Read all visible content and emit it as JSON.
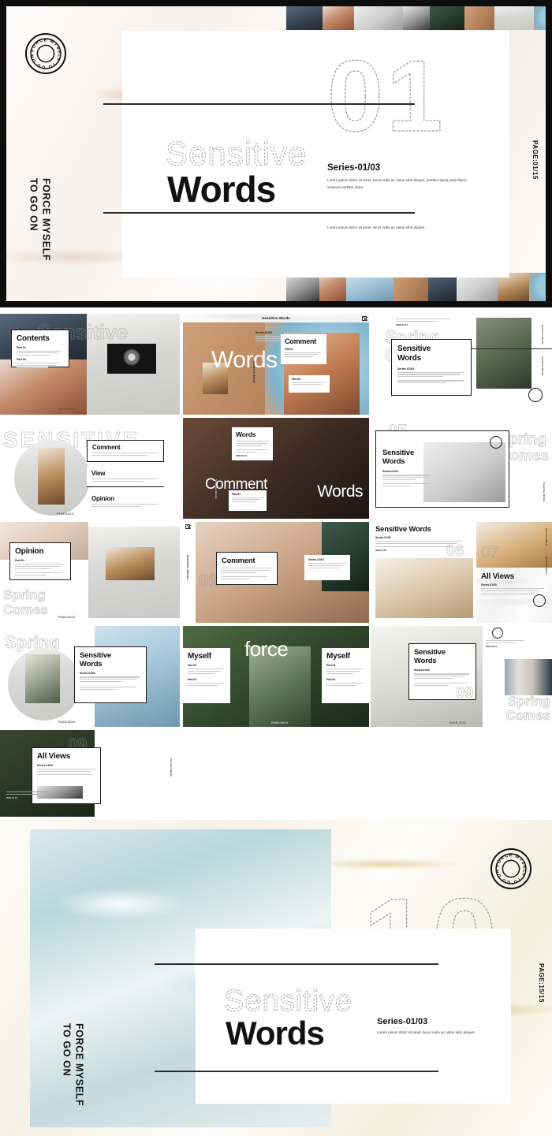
{
  "brand": {
    "stamp_text": "FORCE MYSELF TO GO ON",
    "vertical_line1": "FORCE MYSELF",
    "vertical_line2": "TO GO ON"
  },
  "hero_top": {
    "page_label": "PAGE:01/15",
    "number": "01",
    "outline_word": "Sensitive",
    "title": "Words",
    "series": "Series-01/03",
    "body1": "Lorem ipsum dolor sit amet, lacus nulla ac natus nibh aliquet, porttitor ligula justo libero vivamus porttitor dolor.",
    "body2": "Lorem ipsum dolor sit amet, lacus nulla ac natus nibh aliquet."
  },
  "hero_bottom": {
    "page_label": "PAGE:15/15",
    "number": "10",
    "outline_word": "Sensitive",
    "title": "Words",
    "series": "Series-01/03",
    "body1": "Lorem ipsum dolor sit amet, lacus nulla ac natus nibh aliquet."
  },
  "common": {
    "series_label": "Series-01/03",
    "quote": "If I force myself to go on loving you, Then I break down.",
    "date": "2020.04.01",
    "window_title": "Sensitive Words",
    "vertical_label": "Sensitive Words",
    "part_lorem": "Lorem ipsum dolor sit amet, lacus nulla ac natus nibh aliquet porttitor ligula justo libero.",
    "body_lorem": "Lorem ipsum dolor sit amet, lacus nulla ac natus nibh aliquet porttitor ligula justo libero vivamus porttitor dolor."
  },
  "slides": [
    {
      "id": "s01-contents",
      "panel_title": "Contents",
      "parts": [
        "Part.01",
        "Part.02"
      ],
      "ghost_word": "Sensitive",
      "page_tag": "PAGE:02/15"
    },
    {
      "id": "s02-words-comment",
      "window_title": "Sensitive Words",
      "big_word": "Words",
      "panel_title": "Comment",
      "series": "Series-01/03",
      "parts": [
        "Part.01",
        "Part.02"
      ]
    },
    {
      "id": "s03-sensitive-skate",
      "panel_title_l1": "Sensitive",
      "panel_title_l2": "Words",
      "series": "Series-01/03",
      "ghost_word_l1": "Spring",
      "ghost_word_l2": "Comes",
      "ghost_num": "03",
      "quote": "If I force myself to go on loving you, Then I break down.",
      "date": "2020.04.01"
    },
    {
      "id": "s04-sensitive-ghost",
      "ghost_word": "SENSITIVE",
      "menu": [
        "Comment",
        "View",
        "Opinion"
      ],
      "page_tag": "PAGE:04/15"
    },
    {
      "id": "s05-comment-dark",
      "panel_title": "Words",
      "big_word_l": "Comment",
      "big_word_r": "Words",
      "part": "Part.01",
      "date": "2020.04.01"
    },
    {
      "id": "s06-book",
      "panel_title_l1": "Sensitive",
      "panel_title_l2": "Words",
      "series": "Series-01/03",
      "ghost_num": "05",
      "ghost_word_l1": "Spring",
      "ghost_word_l2": "Comes"
    },
    {
      "id": "s07-opinion",
      "panel_title": "Opinion",
      "part": "Part.01",
      "ghost_word_l1": "Spring",
      "ghost_word_l2": "Comes",
      "page_tag": "PAGE:05/15"
    },
    {
      "id": "s08-flower-comment",
      "vertical_label": "Sensitive Words",
      "panel_title": "Comment",
      "series": "Series-01/03",
      "ghost_num": "01",
      "quote": "If I force myself to go on loving you, Then I break down."
    },
    {
      "id": "s09-sensitive-arch",
      "panel_title": "Sensitive Words",
      "series": "Series-01/03",
      "ghost_num": "06",
      "date": "2020.04.01"
    },
    {
      "id": "s10-all-views",
      "panel_title": "All Views",
      "series": "Series-01/03",
      "ghost_num": "07"
    },
    {
      "id": "s11-spring-tablet",
      "ghost_word": "Spring",
      "page_tag": "PAGE:08/15"
    },
    {
      "id": "s12-sensitive-shop",
      "panel_title_l1": "Sensitive",
      "panel_title_l2": "Words",
      "series": "Series-01/03",
      "quote": "If I force myself to go on loving you, Then I break down."
    },
    {
      "id": "s13-force-myself",
      "big_word": "force",
      "left_word": "Myself",
      "right_word": "Myself",
      "parts": [
        "Part.03",
        "Part.04"
      ],
      "page_tag": "PAGE:09/15"
    },
    {
      "id": "s14-sensitive-build",
      "panel_title_l1": "Sensitive",
      "panel_title_l2": "Words",
      "series": "Series-01/03",
      "ghost_num": "09",
      "page_tag": "PAGE:10/15"
    },
    {
      "id": "s15-spring-mag",
      "quote": "If I force myself to go on loving you, Then I break down.",
      "date": "2020.04.01",
      "ghost_word_l1": "Spring",
      "ghost_word_l2": "Comes"
    },
    {
      "id": "s16-all-views-green",
      "panel_title": "All Views",
      "series": "Series-01/03",
      "ghost_num": "09",
      "quote": "If I force myself to go on loving you, Then I break down.",
      "date": "2020.04.01"
    }
  ],
  "colors": {
    "ink": "#111111",
    "frame": "#0d0d0d",
    "rose_marble": "#f7f1ee",
    "gold_marble": "#f6f1e4"
  }
}
